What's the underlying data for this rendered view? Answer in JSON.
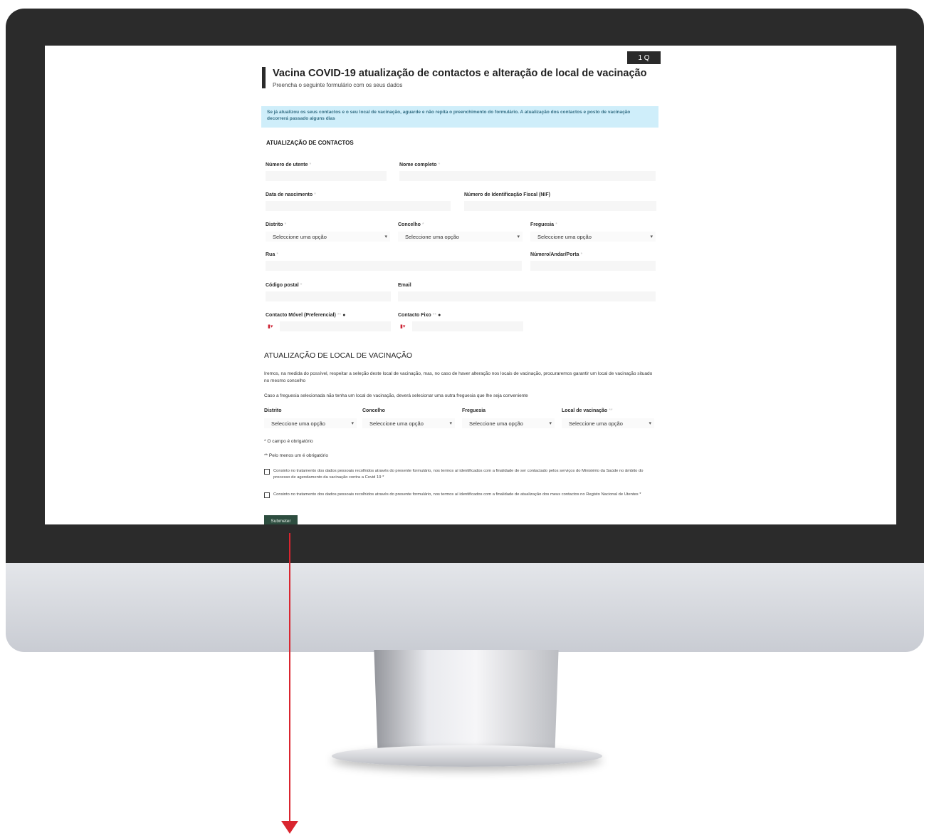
{
  "header": {
    "title": "Vacina COVID-19 atualização de contactos e alteração de local de vacinação",
    "subtitle": "Preencha o seguinte formulário com os seus dados",
    "lang_label": "1 Q"
  },
  "info_box": {
    "text": "Se já atualizou os seus contactos e o seu local de vacinação, aguarde e não repita o preenchimento do formulário. A atualização dos contactos e posto de vacinação decorrerá passado alguns dias"
  },
  "contacts": {
    "section_title": "ATUALIZAÇÃO DE CONTACTOS",
    "user_number_label": "Número de utente",
    "full_name_label": "Nome completo",
    "birth_date_label": "Data de nascimento",
    "nif_label": "Número de Identificação Fiscal (NIF)",
    "district_label": "Distrito",
    "municipality_label": "Concelho",
    "parish_label": "Freguesia",
    "select_placeholder": "Seleccione uma opção",
    "street_label": "Rua",
    "door_label": "Número/Andar/Porta",
    "postal_label": "Código postal",
    "email_label": "Email",
    "mobile_label": "Contacto Móvel (Preferencial)",
    "landline_label": "Contacto Fixo",
    "required_mark": "*",
    "required_double": "**"
  },
  "vaccination": {
    "section_title": "ATUALIZAÇÃO DE LOCAL DE VACINAÇÃO",
    "para1": "Iremos, na medida do possível, respeitar a seleção deste local de vacinação, mas, no caso de haver alteração nos locais de vacinação, procuraremos garantir um local de vacinação situado no mesmo concelho",
    "para2": "Caso a freguesia selecionada não tenha um local de vacinação, deverá selecionar uma outra freguesia que lhe seja conveniente",
    "district_label": "Distrito",
    "municipality_label": "Concelho",
    "parish_label": "Freguesia",
    "site_label": "Local de vacinação"
  },
  "notes": {
    "required_note": "* O campo é obrigatório",
    "one_required_note": "** Pelo menos um é obrigatório"
  },
  "consents": {
    "consent1": "Consinto no tratamento dos dados pessoais recolhidos através do presente formulário, nos termos aí identificados com a finalidade de ser contactado pelos serviços do Ministério da Saúde no âmbito do processo de agendamento da vacinação contra a Covid 19 *",
    "consent2": "Consinto no tratamento dos dados pessoais recolhidos através do presente formulário, nos termos aí identificados com a finalidade de atualização dos meus contactos no Registo Nacional de Utentes *"
  },
  "submit_label": "Submeter",
  "colors": {
    "info_bg": "#cfeefa",
    "submit_bg": "#2d4d3f",
    "annotation_arrow": "#d9252f"
  }
}
